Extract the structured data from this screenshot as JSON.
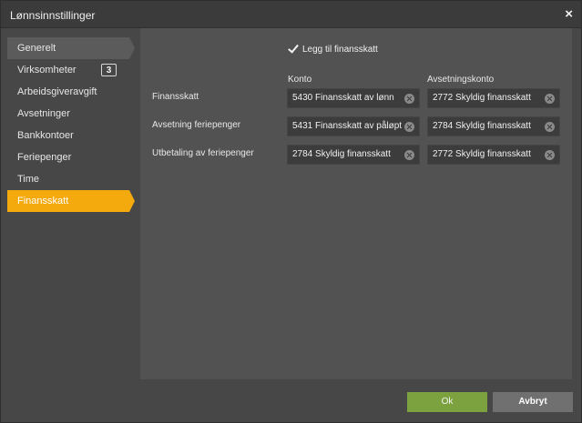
{
  "window": {
    "title": "Lønnsinnstillinger",
    "close_symbol": "×"
  },
  "sidebar": {
    "items": [
      {
        "label": "Generelt"
      },
      {
        "label": "Virksomheter",
        "badge": "3"
      },
      {
        "label": "Arbeidsgiveravgift"
      },
      {
        "label": "Avsetninger"
      },
      {
        "label": "Bankkontoer"
      },
      {
        "label": "Feriepenger"
      },
      {
        "label": "Time"
      },
      {
        "label": "Finansskatt"
      }
    ],
    "active_index": 7
  },
  "main": {
    "checkbox_label": "Legg til finansskatt",
    "checkbox_checked": true,
    "col_headers": {
      "konto": "Konto",
      "avsetningskonto": "Avsetningskonto"
    },
    "rows": [
      {
        "label": "Finansskatt",
        "konto": "5430 Finansskatt av lønn",
        "avsetningskonto": "2772 Skyldig finansskatt"
      },
      {
        "label": "Avsetning feriepenger",
        "konto": "5431 Finansskatt av påløpt",
        "avsetningskonto": "2784 Skyldig finansskatt"
      },
      {
        "label": "Utbetaling av feriepenger",
        "konto": "2784 Skyldig finansskatt",
        "avsetningskonto": "2772 Skyldig finansskatt"
      }
    ]
  },
  "footer": {
    "ok_label": "Ok",
    "cancel_label": "Avbryt"
  },
  "colors": {
    "active": "#f4a90c",
    "ok_button": "#7ba23f",
    "cancel_button": "#707070"
  }
}
